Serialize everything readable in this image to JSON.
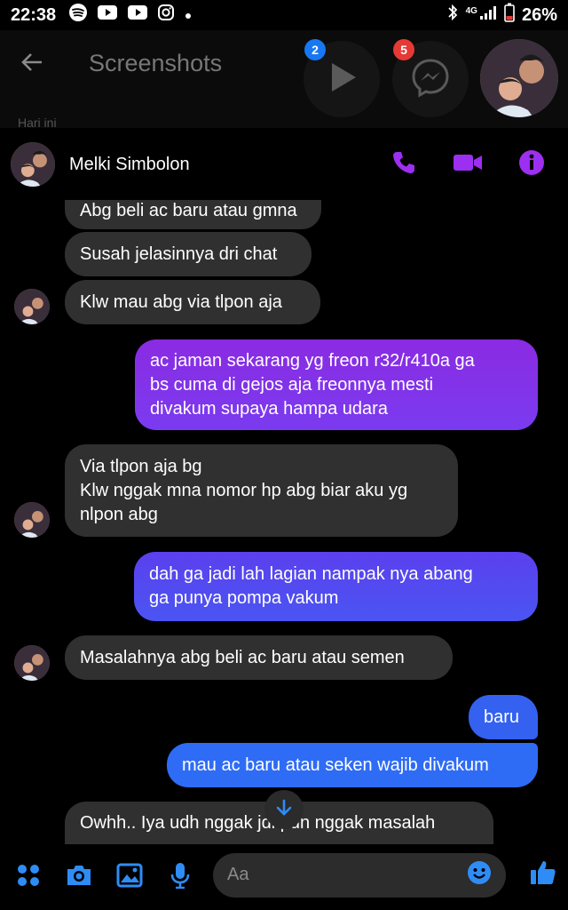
{
  "status": {
    "time": "22:38",
    "battery": "26%",
    "network": "4G"
  },
  "appbar": {
    "title": "Screenshots",
    "subtitle": "Hari ini"
  },
  "bubbles": {
    "video_badge": "2",
    "messenger_badge": "5"
  },
  "chat": {
    "contact_name": "Melki Simbolon",
    "messages": [
      {
        "side": "in",
        "text": "Abg beli ac baru atau gmna"
      },
      {
        "side": "in",
        "text": "Susah jelasinnya dri chat"
      },
      {
        "side": "in",
        "text": "Klw mau abg via tlpon aja"
      },
      {
        "side": "out",
        "lines": [
          "ac jaman sekarang yg freon r32/r410a ga",
          "bs cuma di gejos aja freonnya mesti",
          "divakum supaya hampa udara"
        ]
      },
      {
        "side": "in",
        "lines": [
          "Via tlpon aja bg",
          "Klw nggak mna nomor hp abg biar aku yg",
          "nlpon abg"
        ]
      },
      {
        "side": "out",
        "lines": [
          "dah ga jadi lah lagian nampak nya abang",
          "ga punya pompa vakum"
        ]
      },
      {
        "side": "in",
        "text": "Masalahnya abg beli ac baru atau semen"
      },
      {
        "side": "out",
        "text": "baru"
      },
      {
        "side": "out",
        "text": "mau ac baru atau seken wajib divakum"
      },
      {
        "side": "in",
        "text": "Owhh.. Iya udh nggak jdi pun nggak masalah"
      }
    ]
  },
  "composer": {
    "placeholder": "Aa"
  },
  "colors": {
    "accent": "#9d2ff0",
    "out_top": "#8a2be2",
    "out_bottom": "#2f6cf5",
    "in_bubble": "#303030"
  }
}
